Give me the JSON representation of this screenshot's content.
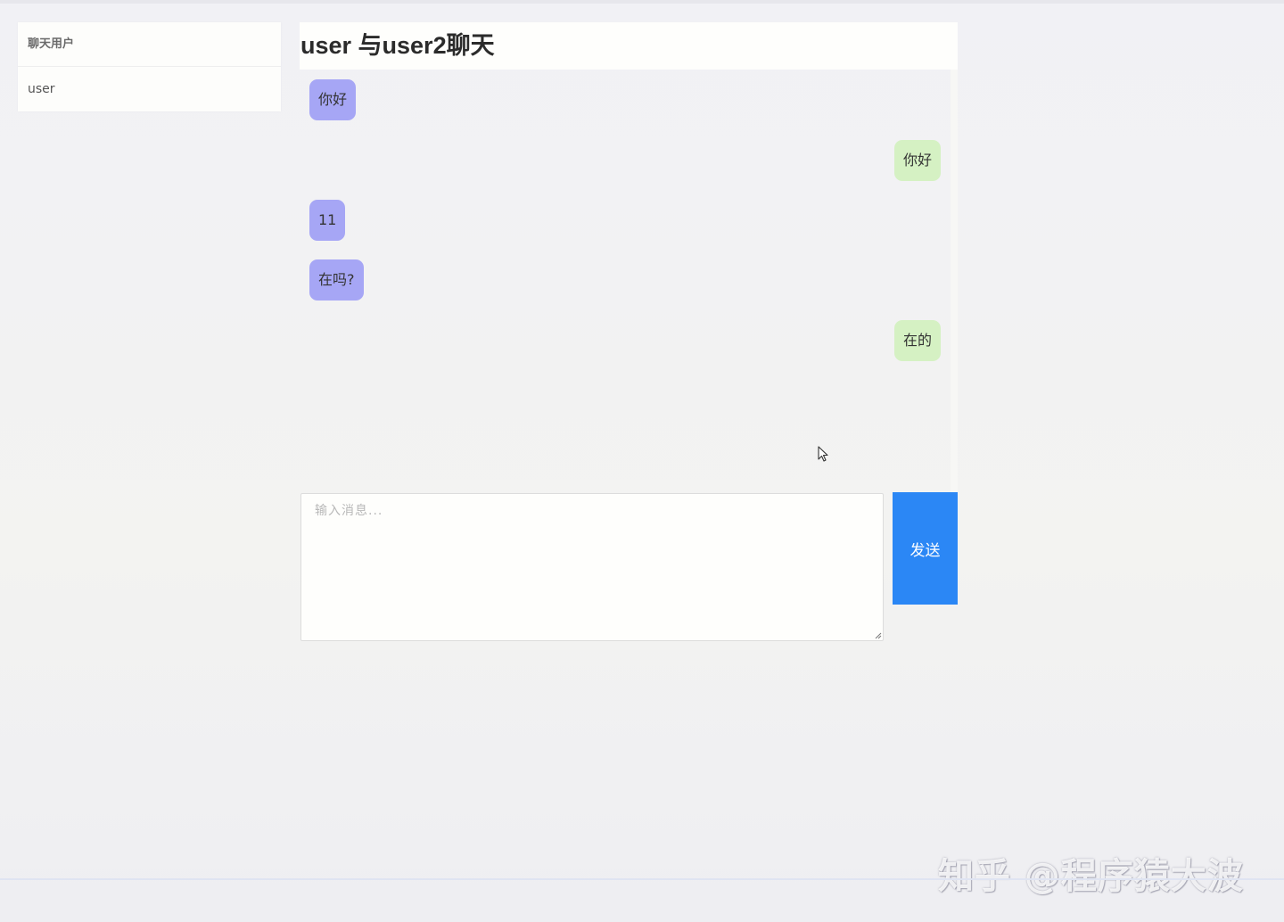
{
  "sidebar": {
    "header": "聊天用户",
    "items": [
      {
        "label": "user"
      }
    ]
  },
  "chat": {
    "title": "user 与user2聊天",
    "messages": [
      {
        "text": "你好",
        "side": "left"
      },
      {
        "text": "你好",
        "side": "right"
      },
      {
        "text": "11",
        "side": "left"
      },
      {
        "text": "在吗?",
        "side": "left"
      },
      {
        "text": "在的",
        "side": "right"
      }
    ]
  },
  "input": {
    "value": "",
    "placeholder": "输入消息..."
  },
  "send": {
    "label": "发送"
  },
  "watermark": "知乎 @程序猿大波",
  "colors": {
    "left_bubble": "#a6a6f5",
    "right_bubble": "#d5f1c3",
    "send_button": "#2b87f5"
  }
}
